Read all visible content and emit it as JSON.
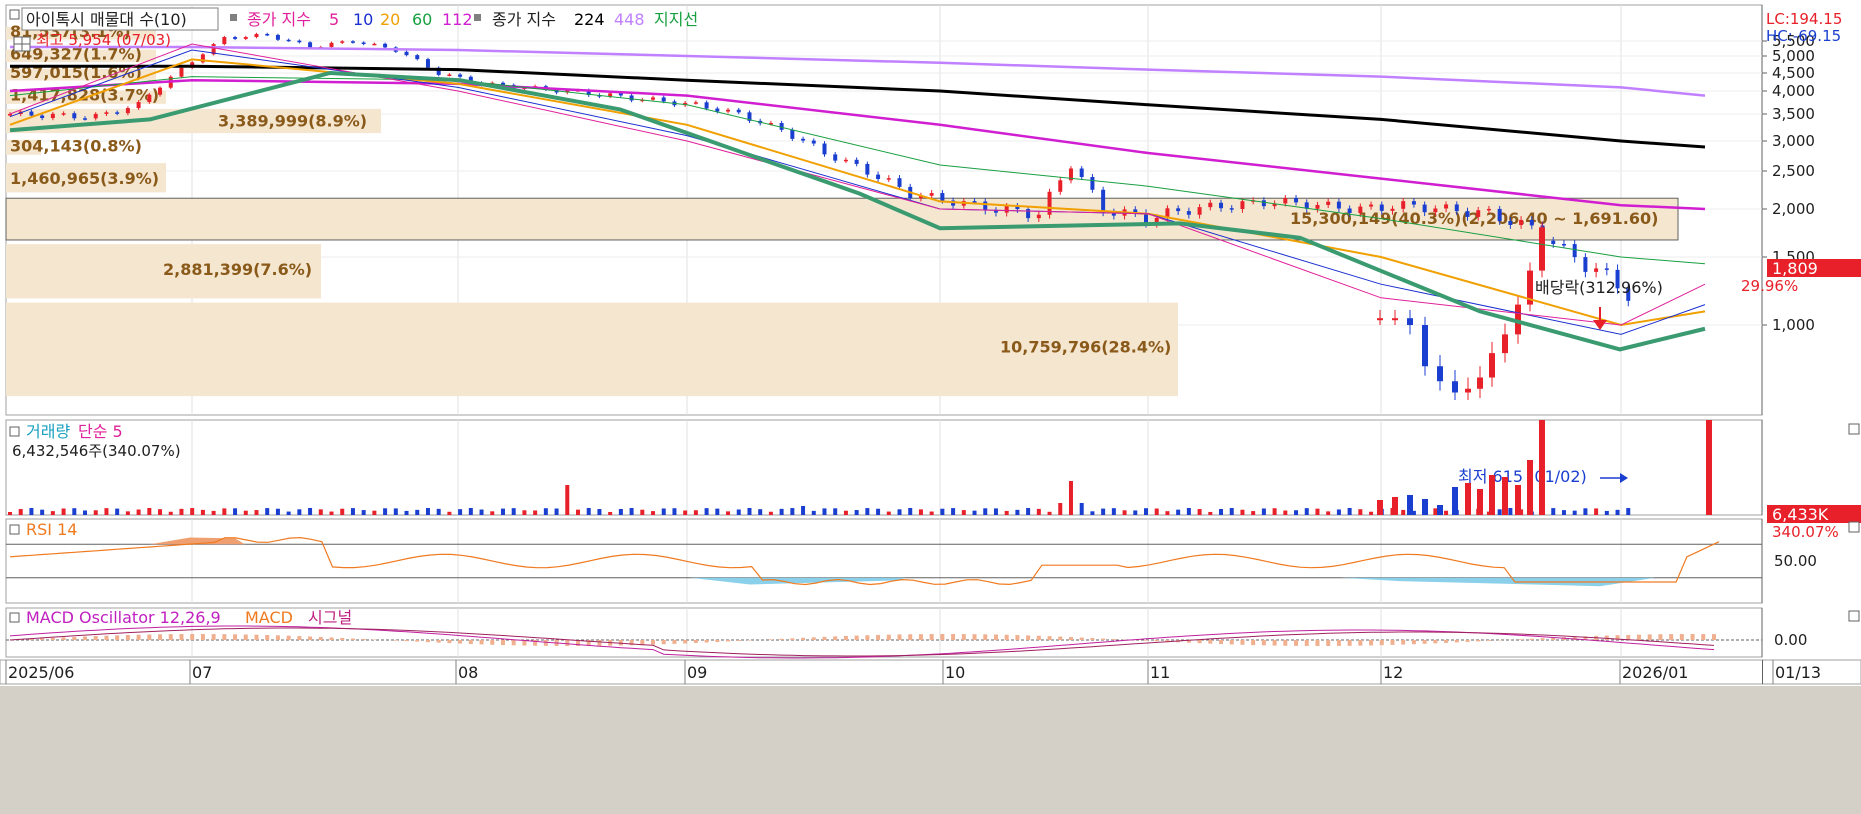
{
  "price_panel": {
    "legend_vp": "아이톡시 매물대 수(10)",
    "legend_ma_prefix": "종가 지수",
    "legend_ma_periods": [
      "5",
      "10",
      "20",
      "60",
      "112"
    ],
    "legend_ma_colors": [
      "#e0209a",
      "#1a2fd0",
      "#f0a000",
      "#18a040",
      "#d01ed0"
    ],
    "legend_ma2_prefix": "종가 지수",
    "legend_ma2_periods": [
      "224",
      "448"
    ],
    "legend_ma2_colors": [
      "#000000",
      "#c080ff"
    ],
    "legend_support": "지지선",
    "legend_support_color": "#18a040",
    "lc_label": "LC:194.15",
    "hc_label": "HC:-69.15",
    "high_label": "최고 5,954 (07/03)",
    "low_label": "최저 615 (01/02)",
    "last_price_tag": "1,809",
    "last_change_tag": "29.96%",
    "dividend_label": "배당락(312.96%)",
    "y_ticks": [
      "5,500",
      "5,000",
      "4,500",
      "4,000",
      "3,500",
      "3,000",
      "2,500",
      "2,000",
      "1,500",
      "1,000"
    ]
  },
  "volume_profile": [
    {
      "label": "81,537(3.1%)"
    },
    {
      "label": "649,327(1.7%)"
    },
    {
      "label": "597,015(1.6%)"
    },
    {
      "label": "1,417,828(3.7%)"
    },
    {
      "label": "3,389,999(8.9%)"
    },
    {
      "label": "304,143(0.8%)"
    },
    {
      "label": "1,460,965(3.9%)"
    },
    {
      "label": "15,300,149(40.3%)(2,206.40 ~ 1,691.60)"
    },
    {
      "label": "2,881,399(7.6%)"
    },
    {
      "label": "10,759,796(28.4%)"
    }
  ],
  "volume_panel": {
    "legend_label": "거래량",
    "legend_ma": "단순 5",
    "value_label": "6,432,546주(340.07%)",
    "tag_value": "6,433K",
    "tag_change": "340.07%"
  },
  "rsi_panel": {
    "legend": "RSI 14",
    "tick": "50.00"
  },
  "macd_panel": {
    "legend_osc": "MACD Oscillator 12,26,9",
    "legend_macd": "MACD",
    "legend_signal": "시그널",
    "tick": "0.00"
  },
  "x_axis": {
    "labels": [
      "2025/06",
      "07",
      "08",
      "09",
      "10",
      "11",
      "12",
      "2026/01",
      "01/13"
    ]
  },
  "colors": {
    "up": "#e8202a",
    "down": "#1a3fd0",
    "vp_fill": "#f5e6d0",
    "vp_text": "#8a5a1a",
    "ma5": "#e0209a",
    "ma10": "#1a2fd0",
    "ma20": "#f0a000",
    "ma60": "#18a040",
    "ma112": "#d01ed0",
    "ma224": "#000000",
    "ma448": "#c080ff",
    "support": "#3a9a70"
  },
  "chart_data": {
    "type": "candlestick",
    "x": [
      "2025/06",
      "07",
      "08",
      "09",
      "10",
      "11",
      "12",
      "2026/01",
      "01/13"
    ],
    "price_range": [
      615,
      5954
    ],
    "series": [
      {
        "name": "종가 지수 5",
        "approx": [
          3500,
          5400,
          4000,
          3000,
          2000,
          1950,
          1200,
          1000,
          1300
        ]
      },
      {
        "name": "종가 지수 10",
        "approx": [
          3450,
          5200,
          4100,
          3100,
          2000,
          1950,
          1300,
          950,
          1150
        ]
      },
      {
        "name": "종가 지수 20",
        "approx": [
          3300,
          4900,
          4200,
          3300,
          2100,
          1950,
          1500,
          1000,
          1100
        ]
      },
      {
        "name": "종가 지수 60",
        "approx": [
          3900,
          4400,
          4300,
          3700,
          2600,
          2300,
          1900,
          1500,
          1450
        ]
      },
      {
        "name": "종가 지수 112",
        "approx": [
          4000,
          4300,
          4200,
          3900,
          3300,
          2800,
          2400,
          2050,
          2000
        ]
      },
      {
        "name": "종가 지수 224",
        "approx": [
          4700,
          4700,
          4600,
          4300,
          4000,
          3700,
          3400,
          3000,
          2900
        ]
      },
      {
        "name": "종가 지수 448",
        "approx": [
          5300,
          5300,
          5200,
          5000,
          4800,
          4600,
          4400,
          4100,
          3900
        ]
      }
    ],
    "high": {
      "value": 5954,
      "date": "07/03"
    },
    "low": {
      "value": 615,
      "date": "01/02"
    },
    "last": 1809,
    "last_change_pct": 29.96,
    "volume_last": 6432546,
    "rsi_mid": 50.0
  }
}
